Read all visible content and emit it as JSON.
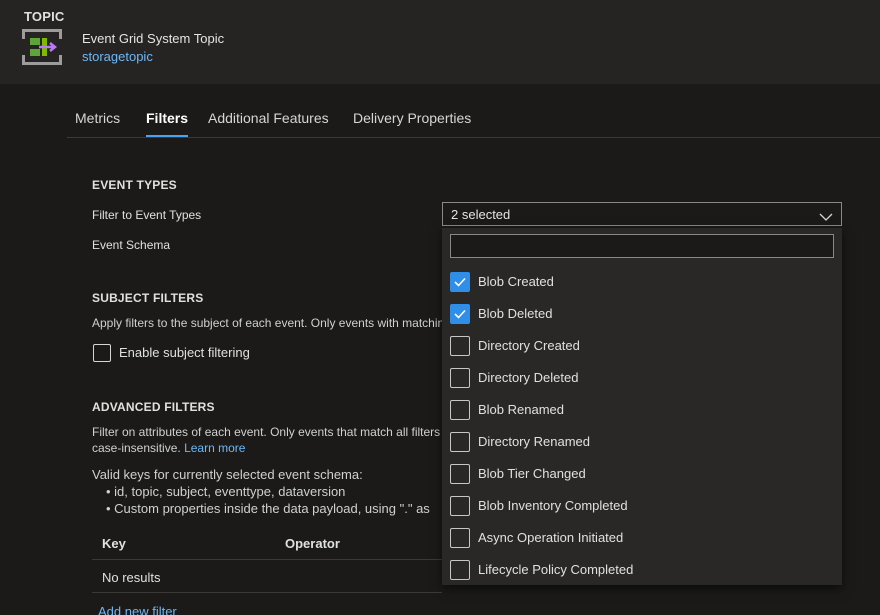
{
  "header": {
    "kind": "TOPIC",
    "resource_name": "Event Grid System Topic",
    "resource_link": "storagetopic",
    "icon": "event-grid-topic-icon"
  },
  "tabs": [
    {
      "label": "Metrics",
      "active": false
    },
    {
      "label": "Filters",
      "active": true
    },
    {
      "label": "Additional Features",
      "active": false
    },
    {
      "label": "Delivery Properties",
      "active": false
    }
  ],
  "event_types": {
    "title": "EVENT TYPES",
    "filter_label": "Filter to Event Types",
    "filter_value": "2 selected",
    "schema_label": "Event Schema",
    "search_placeholder": "",
    "options": [
      {
        "label": "Blob Created",
        "checked": true
      },
      {
        "label": "Blob Deleted",
        "checked": true
      },
      {
        "label": "Directory Created",
        "checked": false
      },
      {
        "label": "Directory Deleted",
        "checked": false
      },
      {
        "label": "Blob Renamed",
        "checked": false
      },
      {
        "label": "Directory Renamed",
        "checked": false
      },
      {
        "label": "Blob Tier Changed",
        "checked": false
      },
      {
        "label": "Blob Inventory Completed",
        "checked": false
      },
      {
        "label": "Async Operation Initiated",
        "checked": false
      },
      {
        "label": "Lifecycle Policy Completed",
        "checked": false
      }
    ]
  },
  "subject_filters": {
    "title": "SUBJECT FILTERS",
    "description": "Apply filters to the subject of each event. Only events with matching",
    "enable_label": "Enable subject filtering",
    "enabled": false
  },
  "advanced_filters": {
    "title": "ADVANCED FILTERS",
    "description_line1": "Filter on attributes of each event. Only events that match all filters",
    "description_line2": "case-insensitive.",
    "learn_more": "Learn more",
    "valid_keys_intro": "Valid keys for currently selected event schema:",
    "bullet1": "id, topic, subject, eventtype, dataversion",
    "bullet2": "Custom properties inside the data payload, using \".\" as",
    "columns": [
      "Key",
      "Operator"
    ],
    "empty_text": "No results",
    "add_label": "Add new filter"
  },
  "colors": {
    "accent": "#2f8ee8",
    "link": "#6cb8f6",
    "background": "#1b1a19",
    "header": "#252423"
  }
}
